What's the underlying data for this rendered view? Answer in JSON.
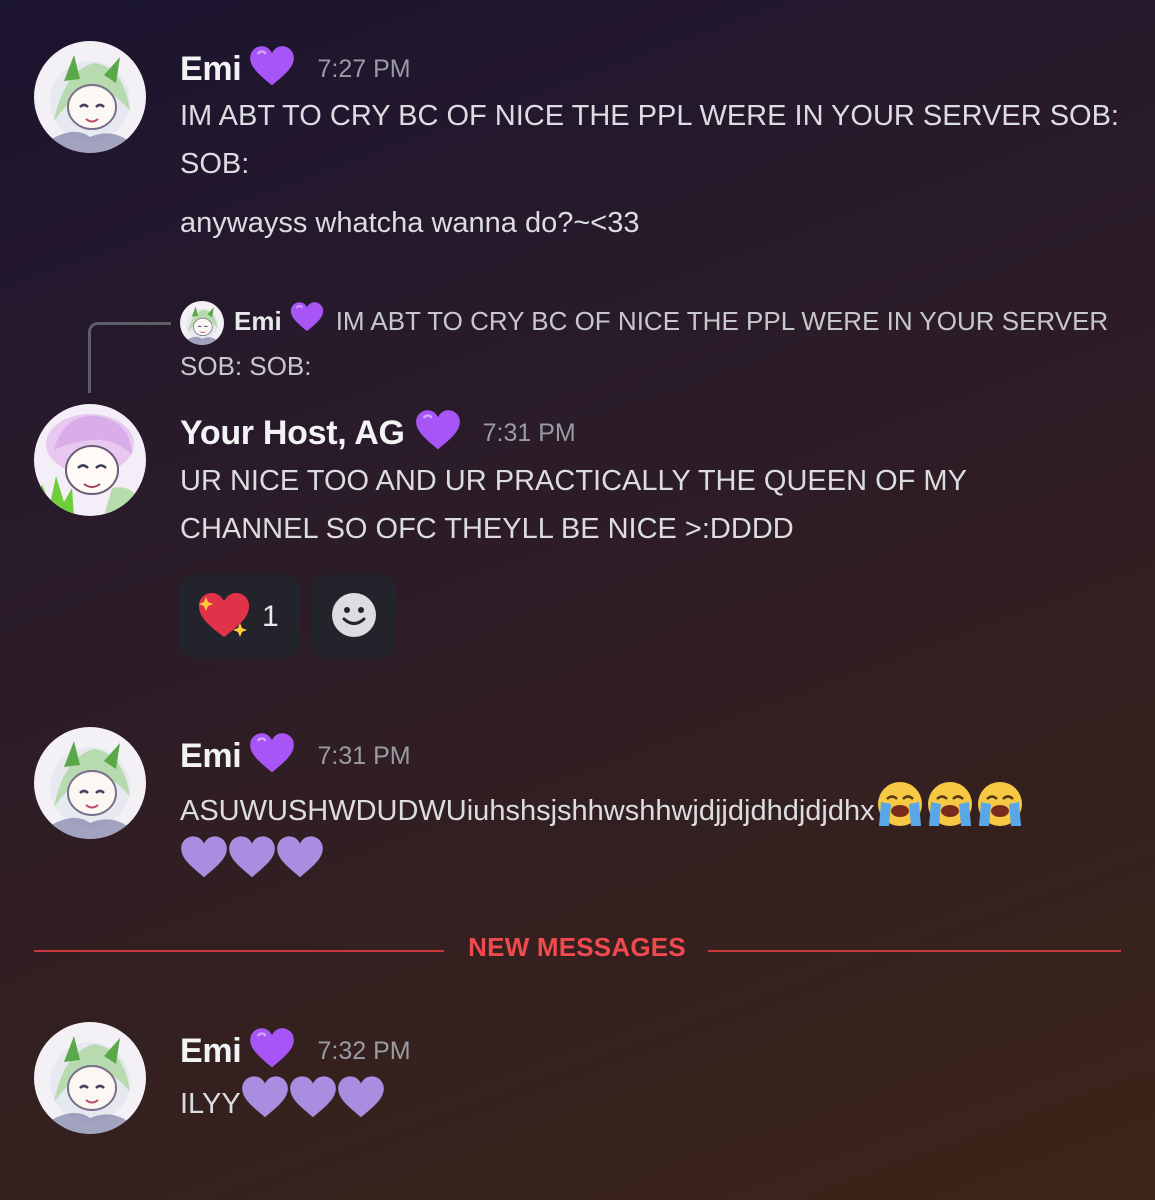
{
  "messages": [
    {
      "author": "Emi",
      "time": "7:27 PM",
      "lines": [
        "IM ABT TO CRY BC OF NICE THE PPL WERE IN YOUR SERVER SOB: SOB:",
        "anywayss whatcha wanna do?~<33"
      ]
    },
    {
      "reply": {
        "author": "Emi",
        "text": "IM ABT TO CRY BC OF NICE THE PPL WERE IN YOUR SERVER SOB: SOB:"
      },
      "author": "Your Host, AG",
      "time": "7:31 PM",
      "text": "UR NICE TOO AND UR PRACTICALLY THE QUEEN OF MY CHANNEL SO OFC THEYLL BE NICE >:DDDD",
      "reactions": [
        {
          "emoji": "sparkling-heart-icon",
          "count": "1"
        },
        {
          "emoji": "add-reaction-icon"
        }
      ]
    },
    {
      "author": "Emi",
      "time": "7:31 PM",
      "text": "ASUWUSHWDUDWUiuhshsjshhwshhwjdjjdjdhdjdjdhx"
    },
    {
      "author": "Emi",
      "time": "7:32 PM",
      "text": "ILYY"
    }
  ],
  "divider_label": "NEW MESSAGES",
  "colors": {
    "heart": "#a855f7",
    "divider": "#c8393d",
    "pale_heart": "#a98de0"
  }
}
